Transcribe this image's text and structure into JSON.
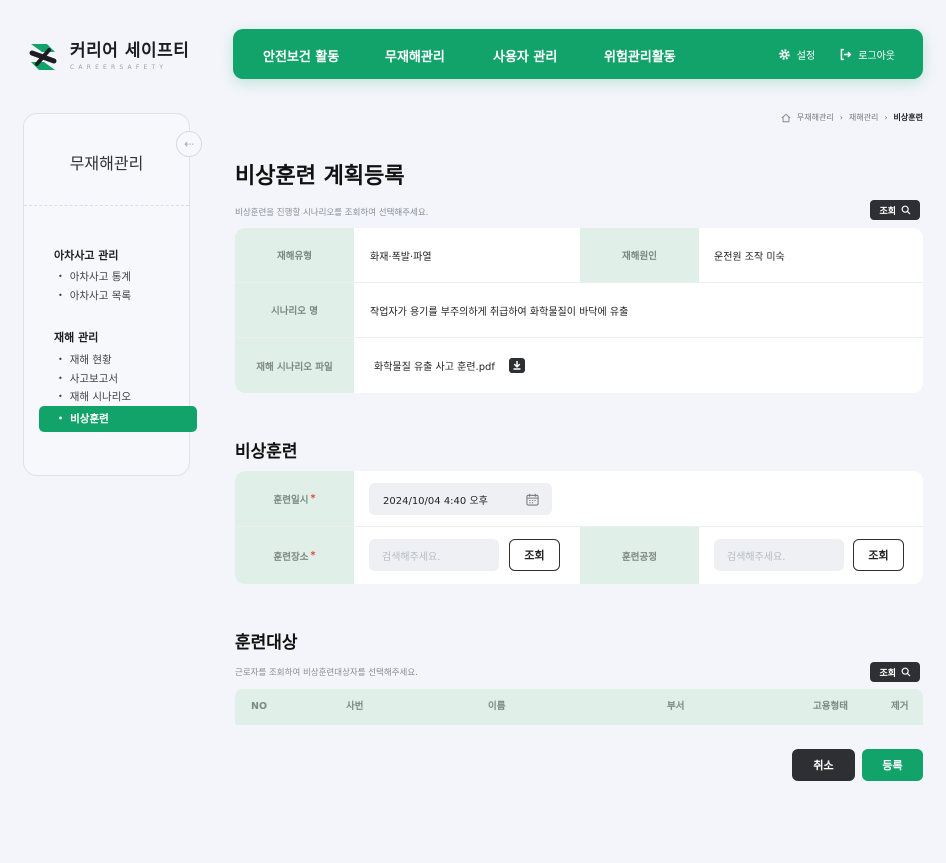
{
  "brand": {
    "name": "커리어 세이프티",
    "sub": "CAREERSAFETY",
    "green": "#12a36a",
    "dark": "#2d2f33"
  },
  "nav": {
    "items": [
      "안전보건 활동",
      "무재해관리",
      "사용자 관리",
      "위험관리활동"
    ],
    "settings": "설정",
    "logout": "로그아웃"
  },
  "sidebar": {
    "title": "무재해관리",
    "groups": [
      {
        "label": "아차사고 관리",
        "items": [
          "아차사고 통계",
          "아차사고 목록"
        ]
      },
      {
        "label": "재해 관리",
        "items": [
          "재해 현황",
          "사고보고서",
          "재해 시나리오",
          "비상훈련"
        ]
      }
    ],
    "active": "비상훈련"
  },
  "breadcrumb": [
    "무재해관리",
    "재해관리",
    "비상훈련"
  ],
  "page": {
    "title": "비상훈련 계획등록",
    "desc": "비상훈련을 진행할 시나리오를 조회하여 선택해주세요.",
    "search_label": "조회"
  },
  "scenario": {
    "type_label": "재해유형",
    "type_value": "화재·폭발·파열",
    "cause_label": "재해원인",
    "cause_value": "운전원 조작 미숙",
    "name_label": "시나리오 명",
    "name_value": "작업자가 용기를 부주의하게 취급하여 화학물질이 바닥에 유출",
    "file_label": "재해 시나리오 파일",
    "file_value": "화학물질 유출 사고 훈련.pdf"
  },
  "drill": {
    "title": "비상훈련",
    "date_label": "훈련일시",
    "date_value": "2024/10/04 4:40 오후",
    "place_label": "훈련장소",
    "place_placeholder": "검색해주세요.",
    "process_label": "훈련공정",
    "process_placeholder": "검색해주세요.",
    "search_button": "조회"
  },
  "target": {
    "title": "훈련대상",
    "desc": "근로자를 조회하여 비상훈련대상자를 선택해주세요.",
    "search_label": "조회",
    "columns": [
      "NO",
      "사번",
      "이름",
      "부서",
      "고용형태",
      "제거"
    ]
  },
  "actions": {
    "cancel": "취소",
    "submit": "등록"
  }
}
